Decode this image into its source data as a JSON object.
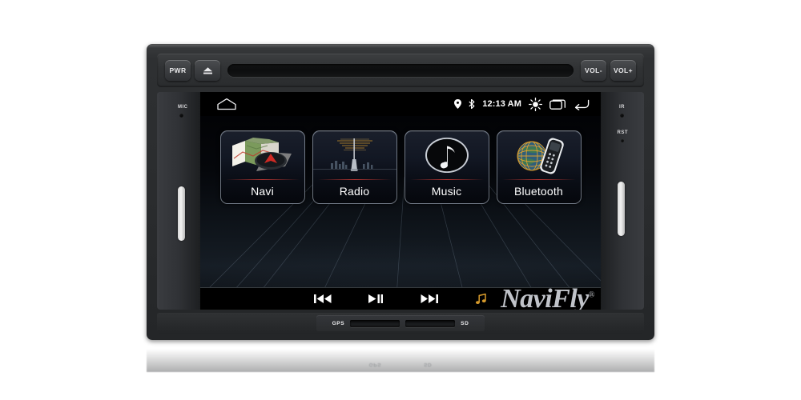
{
  "device": {
    "brand": "NaviFly",
    "brand_mark": "®"
  },
  "hardware": {
    "buttons": [
      {
        "id": "power",
        "label": "PWR",
        "name": "power-button"
      },
      {
        "id": "eject",
        "label": "",
        "name": "eject-button"
      },
      {
        "id": "vol_down",
        "label": "VOL-",
        "name": "volume-down-button"
      },
      {
        "id": "vol_up",
        "label": "VOL+",
        "name": "volume-up-button"
      }
    ],
    "disc_slot_name": "disc-slot",
    "left_pillar": {
      "mic_label": "MIC"
    },
    "right_pillar": {
      "ir_label": "IR",
      "reset_label": "RST"
    },
    "bottom_slots": {
      "gps_label": "GPS",
      "sd_label": "SD"
    }
  },
  "statusbar": {
    "clock": "12:13 AM",
    "icons_left": [
      "home-icon"
    ],
    "icons_right": [
      "location-pin-icon",
      "bluetooth-icon",
      "brightness-icon",
      "recents-icon",
      "back-icon"
    ]
  },
  "apps": [
    {
      "label": "Navi",
      "icon": "map-compass-icon",
      "name": "app-tile-navi"
    },
    {
      "label": "Radio",
      "icon": "radio-tower-icon",
      "name": "app-tile-radio"
    },
    {
      "label": "Music",
      "icon": "music-note-icon",
      "name": "app-tile-music"
    },
    {
      "label": "Bluetooth",
      "icon": "globe-phone-icon",
      "name": "app-tile-bluetooth"
    }
  ],
  "transport": {
    "controls": [
      {
        "id": "previous",
        "icon": "previous-track-icon",
        "name": "previous-track-button"
      },
      {
        "id": "playpause",
        "icon": "play-pause-icon",
        "name": "play-pause-button"
      },
      {
        "id": "next",
        "icon": "next-track-icon",
        "name": "next-track-button"
      },
      {
        "id": "nowplaying",
        "icon": "music-note-icon",
        "name": "now-playing-button"
      }
    ],
    "accent_color": "#d79a2b"
  },
  "colors": {
    "bezel": "#2e3032",
    "screen_bg": "#05070b",
    "tile_border": "#bec8d7",
    "tile_separator": "#d73c37",
    "text": "#ffffff"
  }
}
